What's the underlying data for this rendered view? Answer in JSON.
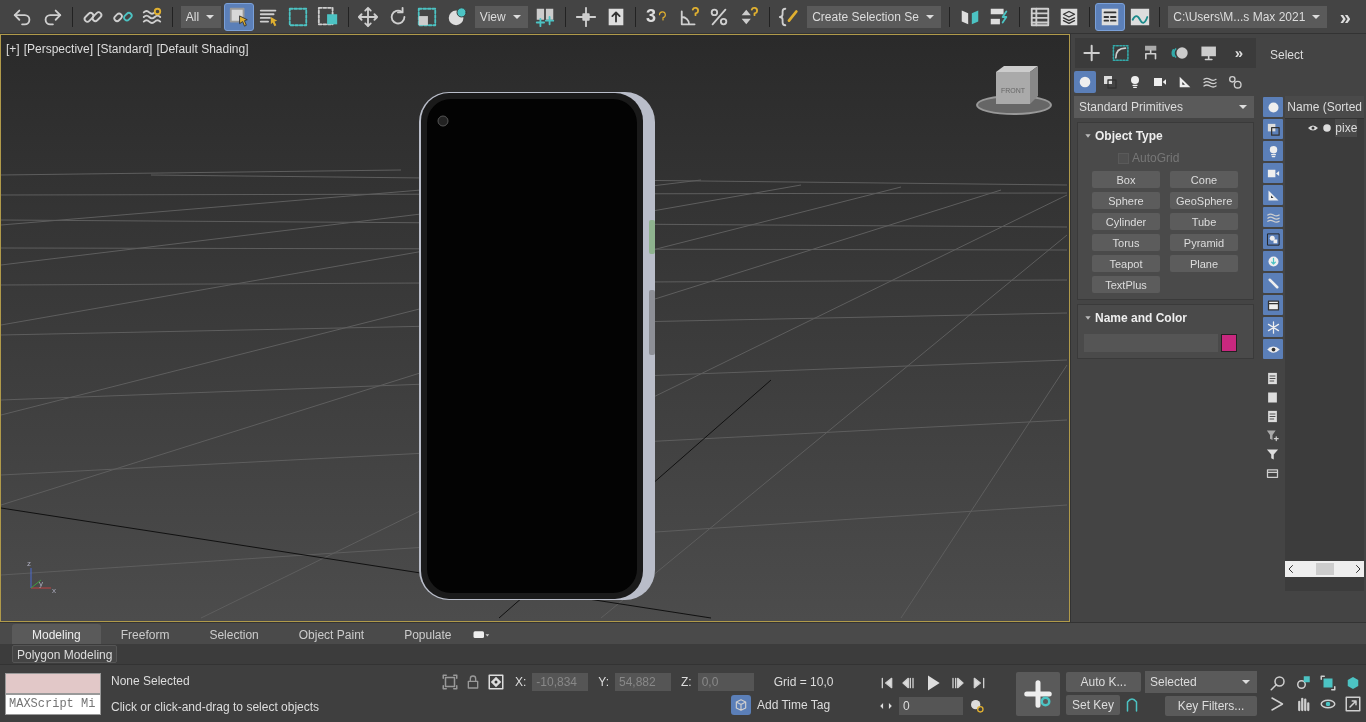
{
  "toolbar": {
    "groups": [
      [
        {
          "kind": "undo",
          "selected": false
        },
        {
          "kind": "redo",
          "selected": false
        }
      ],
      [
        {
          "kind": "link",
          "selected": false
        },
        {
          "kind": "unlink",
          "selected": false
        },
        {
          "kind": "bind",
          "selected": false
        }
      ],
      [
        {
          "kind": "dropdown",
          "value": "All"
        },
        {
          "kind": "select",
          "selected": true
        },
        {
          "kind": "select-by-name",
          "selected": false
        },
        {
          "kind": "rect-region",
          "selected": false
        },
        {
          "kind": "window-crossing",
          "selected": false
        }
      ],
      [
        {
          "kind": "move",
          "selected": false
        },
        {
          "kind": "rotate",
          "selected": false
        },
        {
          "kind": "scale",
          "selected": false
        },
        {
          "kind": "placement",
          "selected": false
        },
        {
          "kind": "dropdown",
          "value": "View"
        },
        {
          "kind": "pivot",
          "selected": false
        }
      ],
      [
        {
          "kind": "manipulate",
          "selected": false
        },
        {
          "kind": "keyboard",
          "selected": false
        }
      ],
      [
        {
          "kind": "snap",
          "label": "3",
          "selected": false
        },
        {
          "kind": "angle-snap",
          "selected": false
        },
        {
          "kind": "percent-snap",
          "selected": false
        },
        {
          "kind": "spinner-snap",
          "selected": false
        }
      ],
      [
        {
          "kind": "edit-named",
          "selected": false
        },
        {
          "kind": "dropdown",
          "value": "Create Selection Se"
        }
      ],
      [
        {
          "kind": "mirror",
          "selected": false
        },
        {
          "kind": "align",
          "selected": false
        }
      ],
      [
        {
          "kind": "explorer",
          "selected": false
        },
        {
          "kind": "layer",
          "selected": false
        }
      ],
      [
        {
          "kind": "ribbon",
          "selected": true
        },
        {
          "kind": "curve-editor",
          "selected": false
        }
      ],
      [
        {
          "kind": "dropdown",
          "value": "C:\\Users\\M...s Max 2021"
        },
        {
          "kind": "overflow",
          "label": "»"
        }
      ]
    ]
  },
  "viewport": {
    "labels": [
      "[+]",
      "[Perspective]",
      "[Standard]",
      "[Default Shading]"
    ],
    "viewcube_label": "FRONT",
    "axis_labels": [
      "z",
      "y",
      "x"
    ]
  },
  "command_panel": {
    "tabs": [
      {
        "kind": "create"
      },
      {
        "kind": "modify"
      },
      {
        "kind": "hierarchy"
      },
      {
        "kind": "motion"
      },
      {
        "kind": "display"
      },
      {
        "kind": "overflow",
        "label": "»"
      }
    ],
    "categories": [
      {
        "kind": "geometry",
        "selected": true
      },
      {
        "kind": "shapes",
        "selected": false
      },
      {
        "kind": "lights",
        "selected": false
      },
      {
        "kind": "cameras",
        "selected": false
      },
      {
        "kind": "helpers",
        "selected": false
      },
      {
        "kind": "spacewarps",
        "selected": false
      },
      {
        "kind": "systems",
        "selected": false
      }
    ],
    "type_dropdown": "Standard Primitives",
    "rollouts": [
      {
        "kind": "object-type",
        "title": "Object Type",
        "expanded": true,
        "autogrid": {
          "label": "AutoGrid",
          "checked": false,
          "disabled": true
        },
        "buttons": [
          "Box",
          "Cone",
          "Sphere",
          "GeoSphere",
          "Cylinder",
          "Tube",
          "Torus",
          "Pyramid",
          "Teapot",
          "Plane",
          "TextPlus"
        ]
      },
      {
        "kind": "name-color",
        "title": "Name and Color",
        "expanded": true,
        "color": "#c8287f"
      }
    ]
  },
  "explorer": {
    "title": "Select",
    "filters": [
      {
        "kind": "geometry",
        "on": true
      },
      {
        "kind": "shapes",
        "on": true
      },
      {
        "kind": "lights",
        "on": true
      },
      {
        "kind": "cameras",
        "on": true
      },
      {
        "kind": "helpers",
        "on": true
      },
      {
        "kind": "spacewarps",
        "on": true
      },
      {
        "kind": "groups",
        "on": true
      },
      {
        "kind": "xrefs",
        "on": true
      },
      {
        "kind": "bones",
        "on": true
      },
      {
        "kind": "containers",
        "on": true
      },
      {
        "kind": "frozen",
        "on": true
      },
      {
        "kind": "hidden",
        "on": true
      }
    ],
    "tools": [
      {
        "kind": "page"
      },
      {
        "kind": "square"
      },
      {
        "kind": "page"
      },
      {
        "kind": "funnel-add"
      },
      {
        "kind": "funnel"
      },
      {
        "kind": "box"
      }
    ],
    "column_header": "Name (Sorted",
    "rows": [
      {
        "name": "pixe",
        "visible": true
      }
    ]
  },
  "ribbon": {
    "tabs": [
      {
        "label": "Modeling",
        "selected": true
      },
      {
        "label": "Freeform",
        "selected": false
      },
      {
        "label": "Selection",
        "selected": false
      },
      {
        "label": "Object Paint",
        "selected": false
      },
      {
        "label": "Populate",
        "selected": false
      }
    ],
    "panel": "Polygon Modeling"
  },
  "status_bar": {
    "listener_placeholder": "MAXScript Mi",
    "selection": "None Selected",
    "prompt": "Click or click-and-drag to select objects",
    "coords": [
      {
        "axis": "X:",
        "value": "-10,834"
      },
      {
        "axis": "Y:",
        "value": "54,882"
      },
      {
        "axis": "Z:",
        "value": "0,0"
      }
    ],
    "grid": "Grid = 10,0",
    "time_tag": "Add Time Tag",
    "frame": "0",
    "auto_key": "Auto K...",
    "set_key": "Set Key",
    "key_mode": "Selected",
    "key_filters": "Key Filters..."
  }
}
